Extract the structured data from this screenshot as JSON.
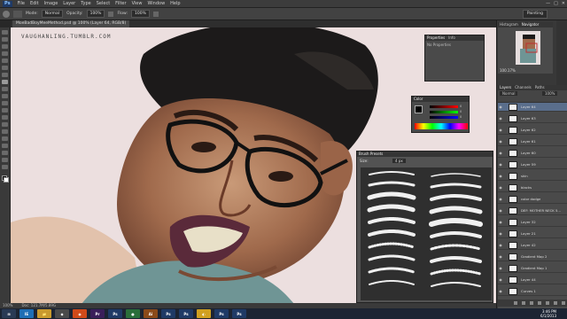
{
  "app": {
    "logo": "Ps"
  },
  "menu": [
    "File",
    "Edit",
    "Image",
    "Layer",
    "Type",
    "Select",
    "Filter",
    "View",
    "Window",
    "Help"
  ],
  "window_controls": [
    "—",
    "□",
    "✕"
  ],
  "options_bar": {
    "mode_label": "Mode:",
    "mode_value": "Normal",
    "opacity_label": "Opacity:",
    "opacity_value": "100%",
    "flow_label": "Flow:",
    "flow_value": "100%"
  },
  "workspace": "Painting",
  "doc_tab": "MoeBadBoyMeeMethod.psd @ 100% (Layer 64, RGB/8)",
  "watermark": "VAUGHANLING.TUMBLR.COM",
  "status": {
    "zoom": "100%",
    "doc": "Doc: 121.7M/5.89G"
  },
  "properties": {
    "tabs": [
      "Properties",
      "Info"
    ],
    "body": "No Properties"
  },
  "color_panel": {
    "title": "Color",
    "fg": "#000000",
    "bg": "#ffffff",
    "values": [
      "0",
      "0",
      "0"
    ]
  },
  "brush_presets": {
    "title": "Brush Presets",
    "size_label": "Size:",
    "size_value": "4 px"
  },
  "navigator": {
    "tabs": [
      "Histogram",
      "Navigator"
    ],
    "zoom": "100.17%"
  },
  "layers_panel": {
    "tabs": [
      "Layers",
      "Channels",
      "Paths"
    ],
    "blend_mode": "Normal",
    "opacity": "100%",
    "layers": [
      {
        "name": "Layer 64",
        "selected": true
      },
      {
        "name": "Layer 63",
        "selected": false
      },
      {
        "name": "Layer 62",
        "selected": false
      },
      {
        "name": "Layer 61",
        "selected": false
      },
      {
        "name": "Layer 60",
        "selected": false
      },
      {
        "name": "Layer 59",
        "selected": false
      },
      {
        "name": "skin",
        "selected": false
      },
      {
        "name": "blacks",
        "selected": false
      },
      {
        "name": "color dodge",
        "selected": false
      },
      {
        "name": "DEF: MOTHER NECK 5...",
        "selected": false
      },
      {
        "name": "Layer 32",
        "selected": false
      },
      {
        "name": "Layer 21",
        "selected": false
      },
      {
        "name": "Layer 42",
        "selected": false
      },
      {
        "name": "Gradient Map 2",
        "selected": false
      },
      {
        "name": "Gradient Map 1",
        "selected": false
      },
      {
        "name": "Layer 44",
        "selected": false
      },
      {
        "name": "Curves 1",
        "selected": false
      }
    ]
  },
  "taskbar": {
    "items": [
      {
        "label": "⊞",
        "color": "#2a3a55"
      },
      {
        "label": "IE",
        "color": "#1f6fb5"
      },
      {
        "label": "📁",
        "color": "#c99a2e"
      },
      {
        "label": "◆",
        "color": "#4a4a4a"
      },
      {
        "label": "◉",
        "color": "#d04a1a"
      },
      {
        "label": "Pr",
        "color": "#3a1f5a"
      },
      {
        "label": "Ps",
        "color": "#1f3a66"
      },
      {
        "label": "●",
        "color": "#2a6e3a"
      },
      {
        "label": "Ai",
        "color": "#8a4a1a"
      },
      {
        "label": "Ps",
        "color": "#1f3a66"
      },
      {
        "label": "Ps",
        "color": "#1f3a66"
      },
      {
        "label": "◐",
        "color": "#d0a020"
      },
      {
        "label": "Ps",
        "color": "#1f3a66"
      },
      {
        "label": "Ps",
        "color": "#1f3a66"
      }
    ],
    "time": "3:46 PM",
    "date": "6/1/2013"
  }
}
